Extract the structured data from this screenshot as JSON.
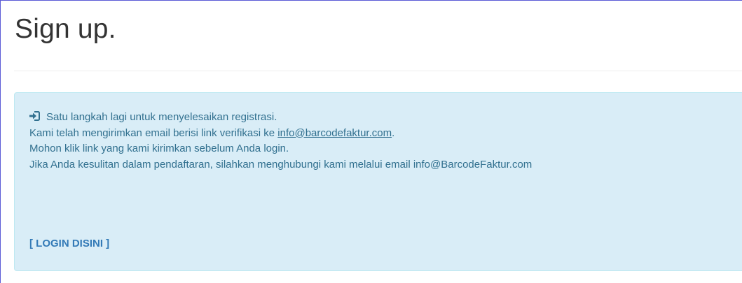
{
  "page": {
    "title": "Sign up."
  },
  "alert": {
    "icon": "login-icon",
    "line1": "Satu langkah lagi untuk menyelesaikan registrasi.",
    "line2_prefix": "Kami telah mengirimkan email berisi link verifikasi ke ",
    "line2_email": "info@barcodefaktur.com",
    "line2_suffix": ".",
    "line3": "Mohon klik link yang kami kirimkan sebelum Anda login.",
    "line4": "Jika Anda kesulitan dalam pendaftaran, silahkan menghubungi kami melalui email info@BarcodeFaktur.com",
    "login_link": "[ LOGIN DISINI ]"
  },
  "colors": {
    "alert_bg": "#d9edf7",
    "alert_border": "#bce8f1",
    "alert_text": "#31708f",
    "link": "#337ab7",
    "title": "#333333"
  }
}
